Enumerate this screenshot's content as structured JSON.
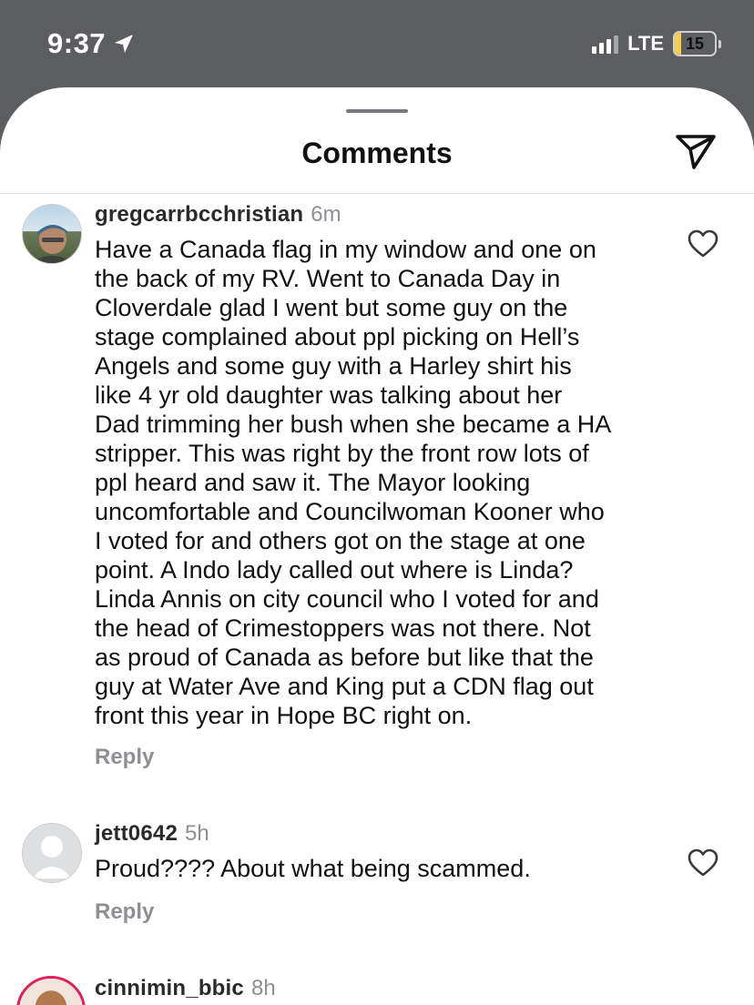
{
  "status": {
    "time": "9:37",
    "network": "LTE",
    "battery": "15",
    "battery_level": 0.15
  },
  "sheet": {
    "title": "Comments",
    "share_icon": "paper-plane-icon"
  },
  "comments": [
    {
      "username": "gregcarrbcchristian",
      "time": "6m",
      "text": "Have a Canada flag in my window and one on\nthe back of my RV. Went to Canada Day in\nCloverdale glad I went but some guy on the\nstage complained about ppl picking on Hell’s\nAngels and some guy with a Harley shirt his\nlike 4 yr old daughter was talking about her\nDad trimming her bush when she became a HA\nstripper. This was right by the front row lots of\nppl heard and saw it. The Mayor looking\nuncomfortable and Councilwoman Kooner who\nI voted for and others got on the stage at one\npoint. A Indo lady called out where is Linda?\nLinda Annis on city council who I voted for and\nthe head of Crimestoppers was not there. Not\nas proud of Canada as before but like that the\nguy at Water Ave and King put a CDN flag out\nfront this year in Hope BC right on.",
      "reply_label": "Reply"
    },
    {
      "username": "jett0642",
      "time": "5h",
      "text": "Proud???? About what being scammed.",
      "reply_label": "Reply"
    },
    {
      "username": "cinnimin_bbic",
      "time": "8h"
    }
  ]
}
